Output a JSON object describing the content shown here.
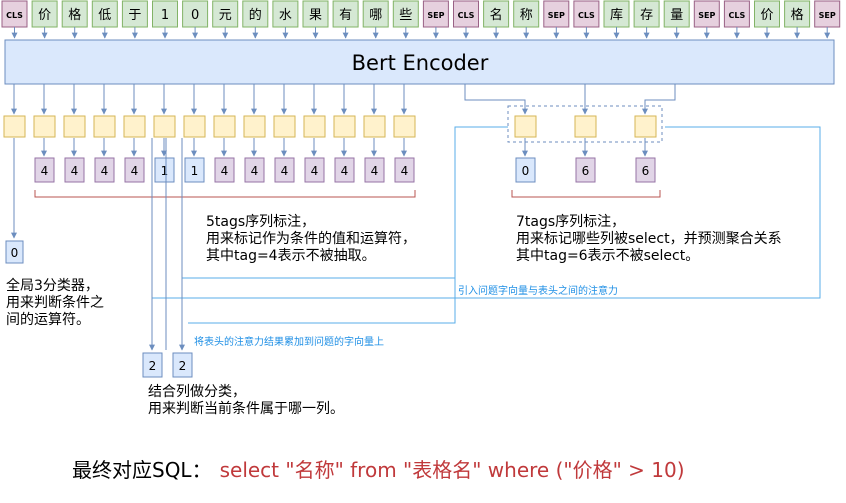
{
  "input_tokens": [
    {
      "text": "CLS",
      "kind": "special"
    },
    {
      "text": "价",
      "kind": "q"
    },
    {
      "text": "格",
      "kind": "q"
    },
    {
      "text": "低",
      "kind": "q"
    },
    {
      "text": "于",
      "kind": "q"
    },
    {
      "text": "1",
      "kind": "q"
    },
    {
      "text": "0",
      "kind": "q"
    },
    {
      "text": "元",
      "kind": "q"
    },
    {
      "text": "的",
      "kind": "q"
    },
    {
      "text": "水",
      "kind": "q"
    },
    {
      "text": "果",
      "kind": "q"
    },
    {
      "text": "有",
      "kind": "q"
    },
    {
      "text": "哪",
      "kind": "q"
    },
    {
      "text": "些",
      "kind": "q"
    },
    {
      "text": "SEP",
      "kind": "special"
    },
    {
      "text": "CLS",
      "kind": "special"
    },
    {
      "text": "名",
      "kind": "q"
    },
    {
      "text": "称",
      "kind": "q"
    },
    {
      "text": "SEP",
      "kind": "special"
    },
    {
      "text": "CLS",
      "kind": "special"
    },
    {
      "text": "库",
      "kind": "q"
    },
    {
      "text": "存",
      "kind": "q"
    },
    {
      "text": "量",
      "kind": "q"
    },
    {
      "text": "SEP",
      "kind": "special"
    },
    {
      "text": "CLS",
      "kind": "special"
    },
    {
      "text": "价",
      "kind": "q"
    },
    {
      "text": "格",
      "kind": "q"
    },
    {
      "text": "SEP",
      "kind": "special"
    }
  ],
  "encoder_label": "Bert Encoder",
  "question_tags": [
    "4",
    "4",
    "4",
    "4",
    "1",
    "1",
    "4",
    "4",
    "4",
    "4",
    "4",
    "4",
    "4"
  ],
  "column_tags": [
    "0",
    "6",
    "6"
  ],
  "operator_output": "0",
  "column_choice": [
    "2",
    "2"
  ],
  "notes": {
    "question_tagging": [
      "5tags序列标注，",
      "用来标记作为条件的值和运算符，",
      "其中tag=4表示不被抽取。"
    ],
    "column_tagging": [
      "7tags序列标注，",
      "用来标记哪些列被select，并预测聚合关系",
      "其中tag=6表示不被select。"
    ],
    "operator_classifier": [
      "全局3分类器，",
      "用来判断条件之",
      "间的运算符。"
    ],
    "column_classifier": [
      "结合列做分类，",
      "用来判断当前条件属于哪一列。"
    ]
  },
  "annotations": {
    "attention": "引入问题字向量与表头之间的注意力",
    "accumulate": "将表头的注意力结果累加到问题的字向量上"
  },
  "sql": {
    "prefix": "最终对应SQL：",
    "query": "select \"名称\" from \"表格名\" where (\"价格\" > 10)"
  },
  "colors": {
    "token_green": "#d5e8d4",
    "token_green_border": "#82b366",
    "token_pink": "#e6d0de",
    "token_pink_border": "#996185",
    "encoder_fill": "#dae8fc",
    "encoder_border": "#6c8ebf",
    "embed_yellow": "#fff2cc",
    "embed_border": "#d6b656",
    "tag_purple": "#e1d5e7",
    "tag_purple_border": "#9673a6",
    "tag_blue": "#dae8fc",
    "bracket_red": "#b85450",
    "arrow_blue": "#6c8ebf",
    "annotation_blue": "#1f8fe5",
    "sql_red": "#c0393b"
  }
}
